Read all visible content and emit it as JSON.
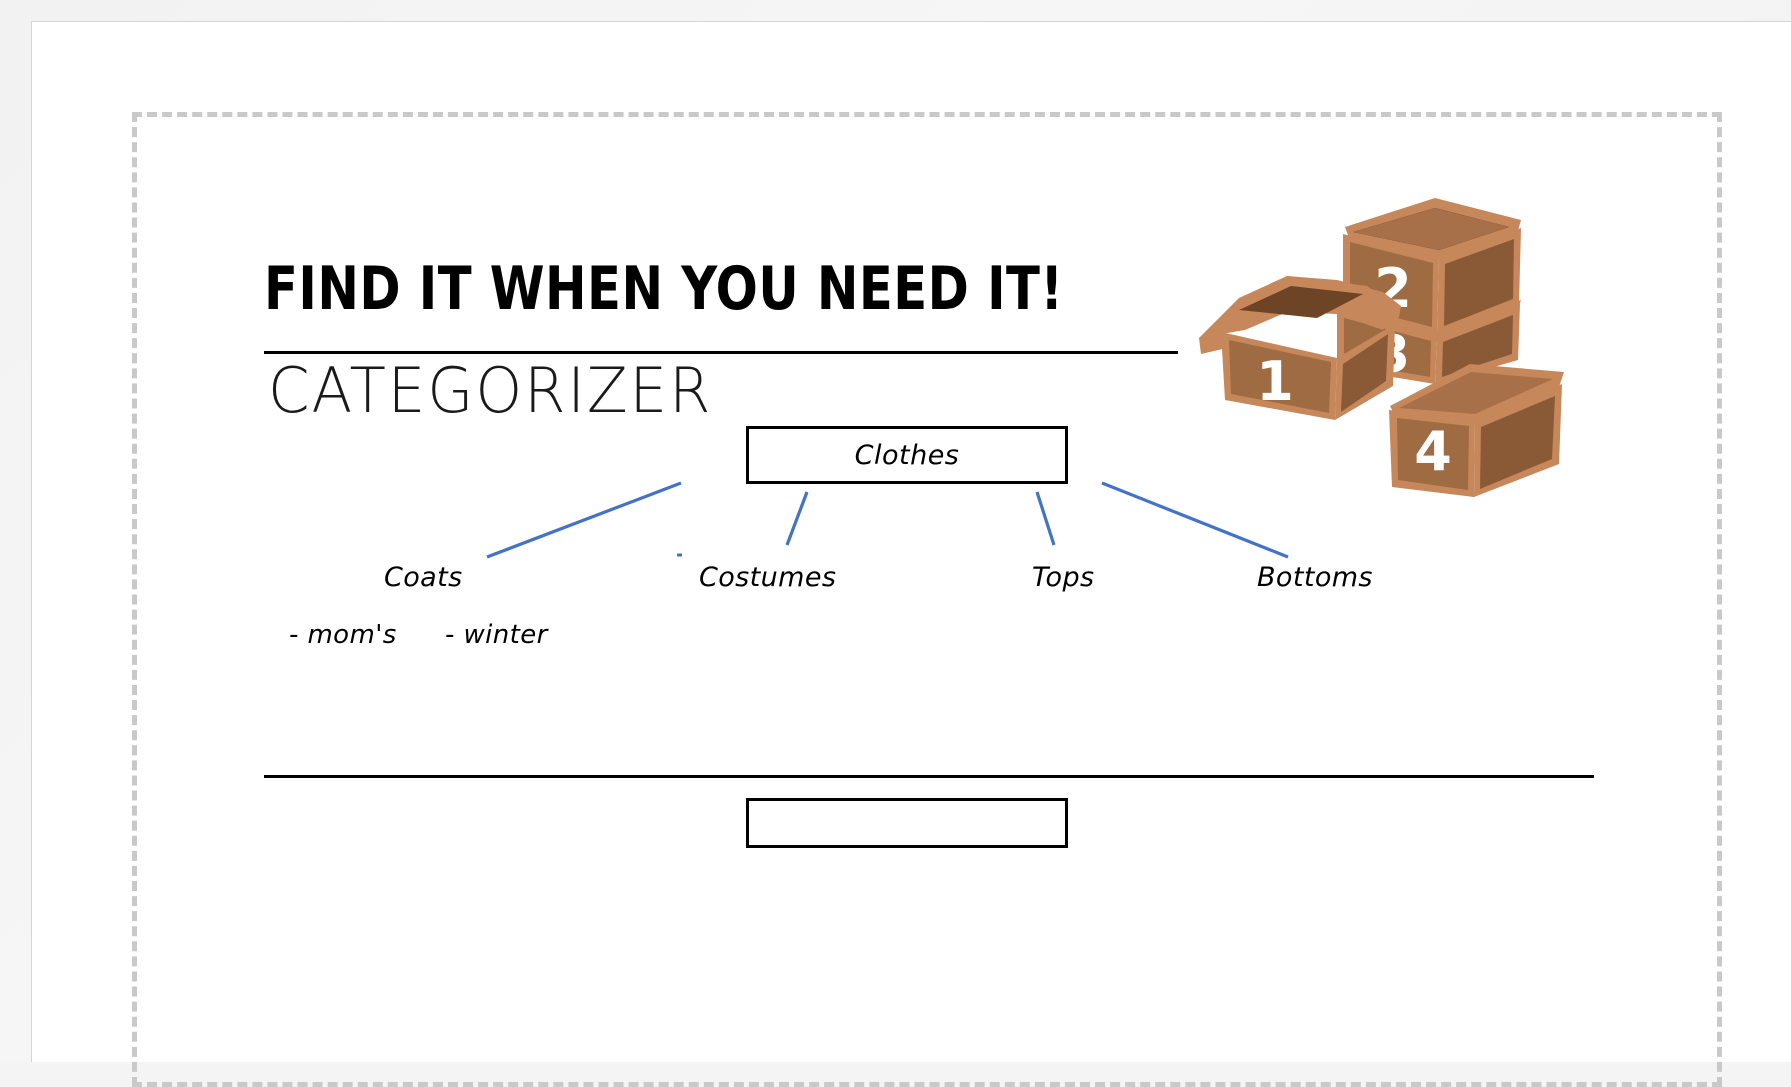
{
  "slide": {
    "title": "FIND IT WHEN YOU NEED IT!",
    "subtitle": "CATEGORIZER"
  },
  "diagram": {
    "root": {
      "label": "Clothes"
    },
    "categories": [
      {
        "label": "Coats"
      },
      {
        "label": "Costumes"
      },
      {
        "label": "Tops"
      },
      {
        "label": "Bottoms"
      }
    ],
    "sub_items": [
      {
        "label": "- mom's"
      },
      {
        "label": "- winter"
      }
    ],
    "empty_box": {
      "label": ""
    },
    "connector_color": "#4472c4"
  },
  "illustration": {
    "name": "cardboard-boxes-illustration",
    "box_numbers": [
      "1",
      "2",
      "3",
      "4"
    ],
    "colors": {
      "outline": "#c6875a",
      "face_light": "#b07a4f",
      "face_mid": "#9f6b43",
      "face_dark": "#8a5a36",
      "interior": "#6d4426",
      "number": "#ffffff"
    }
  },
  "canvas": {
    "background": "#f2f2f2",
    "slide_background": "#ffffff",
    "frame_color": "#c9c9c9",
    "ink_color": "#000000"
  }
}
